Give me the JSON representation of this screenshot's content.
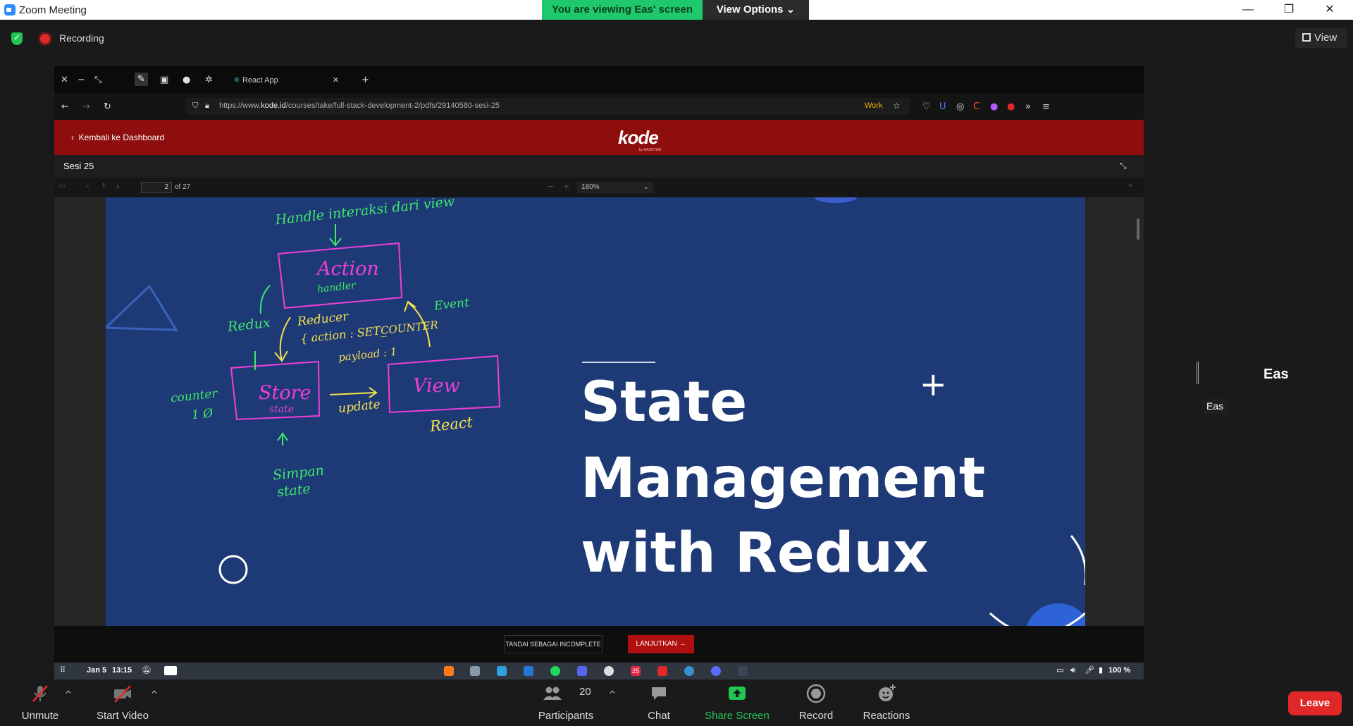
{
  "window": {
    "title": "Zoom Meeting",
    "viewing_banner": "You are viewing Eas' screen",
    "view_options": "View Options",
    "view_button": "View"
  },
  "recording": {
    "label": "Recording"
  },
  "browser": {
    "tab_title": "React App",
    "url_prefix": "https://www.",
    "url_host": "kode.id",
    "url_path": "/courses/take/full-stack-development-2/pdfs/29140580-sesi-25",
    "container_label": "Work"
  },
  "kode": {
    "back_label": "Kembali ke Dashboard",
    "logo": "kode",
    "logo_sub": "by HACKTIV8",
    "session_title": "Sesi 25"
  },
  "pdf": {
    "page_current": "2",
    "page_total": "of 27",
    "zoom": "180%"
  },
  "slide": {
    "title_lines": [
      "State",
      "Management",
      "with Redux"
    ],
    "annotations": {
      "handle": "Handle interaksi dari view",
      "action": "Action",
      "action_sub": "handler",
      "redux": "Redux",
      "reducer": "Reducer",
      "reducer_detail": "{ action : SET_",
      "reducer_detail2": "COUNTER",
      "payload": "payload : 1",
      "event": "Event",
      "store": "Store",
      "store_sub": "state",
      "view": "View",
      "update": "update",
      "react": "React",
      "counter": "counter",
      "counter_val": "1 Ø",
      "simpan": "Simpan",
      "simpan2": "state"
    }
  },
  "actions": {
    "incomplete": "TANDAI SEBAGAI INCOMPLETE",
    "next": "LANJUTKAN →"
  },
  "taskbar": {
    "date": "Jan 5",
    "time": "13:15",
    "badge": "25",
    "battery": "100 %"
  },
  "participant": {
    "name": "Eas",
    "label": "Eas"
  },
  "controls": {
    "unmute": "Unmute",
    "start_video": "Start Video",
    "participants": "Participants",
    "participants_count": "20",
    "chat": "Chat",
    "share_screen": "Share Screen",
    "record": "Record",
    "reactions": "Reactions",
    "leave": "Leave"
  },
  "colors": {
    "share_green": "#23c552",
    "leave_red": "#e02828",
    "slide_bg": "#1e3a76",
    "kode_red": "#8e0d0d"
  }
}
